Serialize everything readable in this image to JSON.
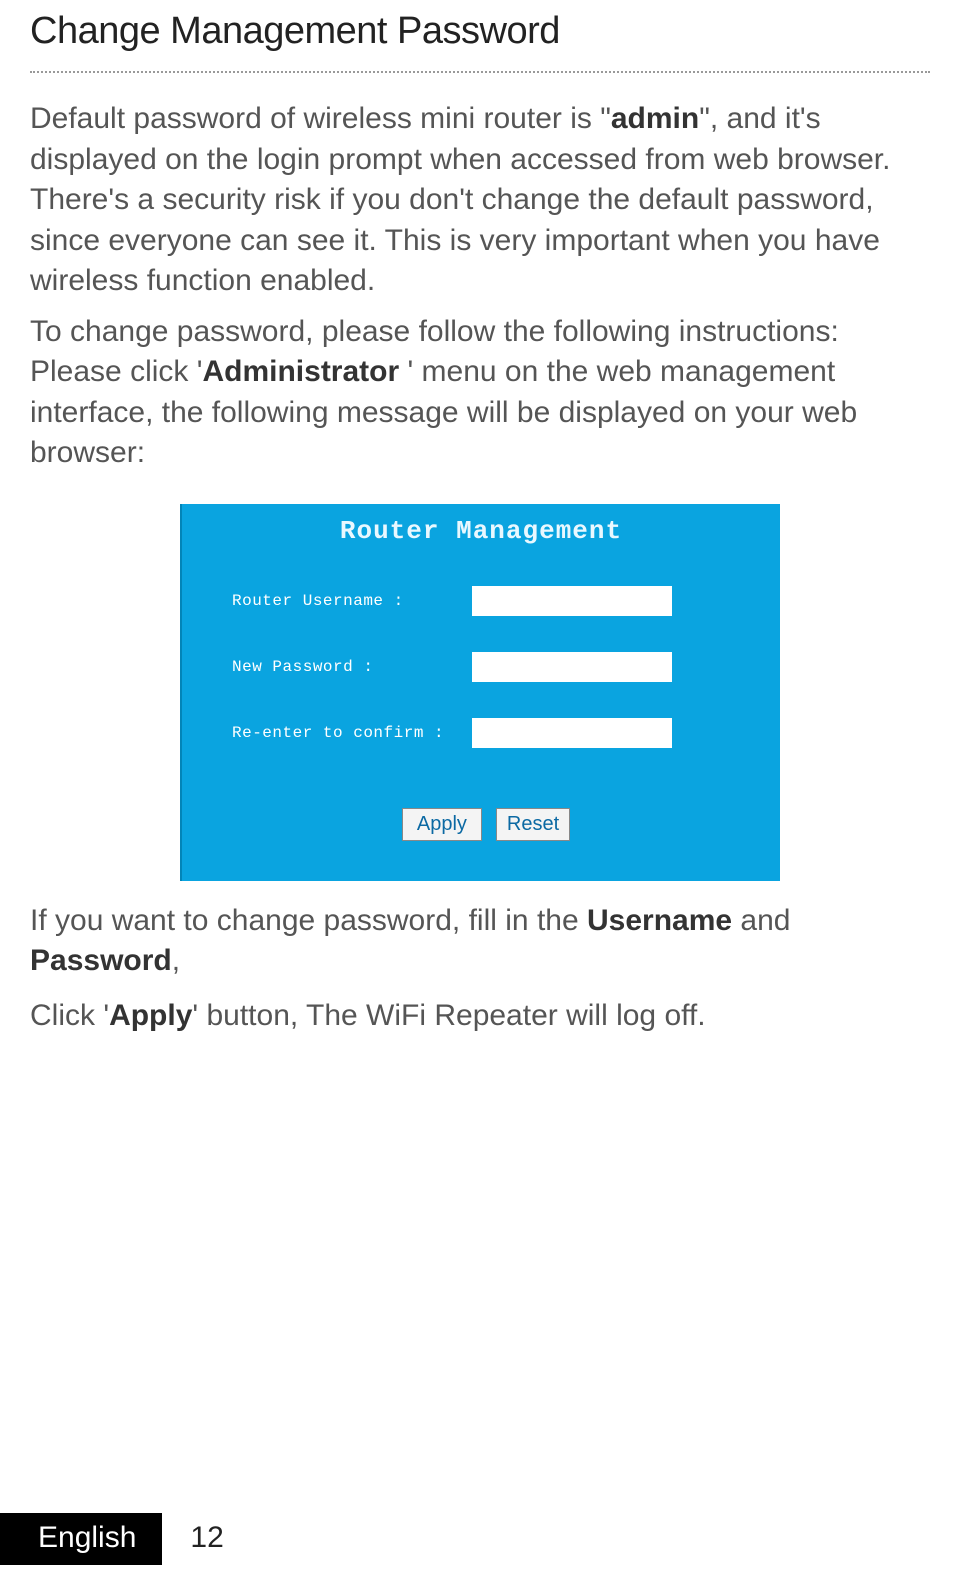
{
  "heading": "Change Management Password",
  "para1_a": "Default password of wireless mini router is \"",
  "para1_bold": "admin",
  "para1_b": "\", and it's displayed on the login prompt when accessed from web browser. There's a security risk if you don't change the default password, since everyone can see it. This is very important when you have wireless function enabled.",
  "para2_a": "To change password, please follow the following instructions: Please click '",
  "para2_bold": "Administrator",
  "para2_b": " ' menu on the web management interface, the following message will be displayed on your web browser:",
  "panel": {
    "title": "Router Management",
    "label_username": "Router Username :",
    "label_newpass": "New Password :",
    "label_confirm": "Re-enter to confirm :",
    "value_username": "",
    "value_newpass": "",
    "value_confirm": "",
    "btn_apply": "Apply",
    "btn_reset": "Reset"
  },
  "para3_a": "If you want to change password, fill in the ",
  "para3_bold1": "Username",
  "para3_b": " and ",
  "para3_bold2": "Password",
  "para3_c": ",",
  "para4_a": "Click '",
  "para4_bold": "Apply",
  "para4_b": "' button, The WiFi Repeater will log off.",
  "footer_lang": "English",
  "footer_page": "12"
}
